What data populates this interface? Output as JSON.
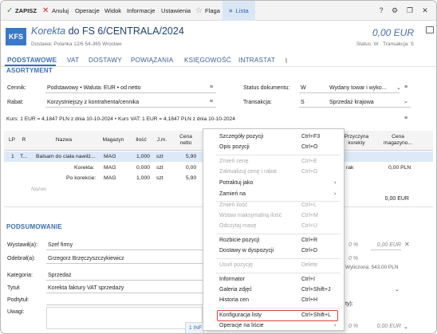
{
  "toolbar": {
    "save": "ZAPISZ",
    "cancel": "Anuluj",
    "operations": "Operacje",
    "view": "Widok",
    "information": "Informacje",
    "settings": "Ustawienia",
    "flag": "Flaga",
    "list": "Lista",
    "help": "?"
  },
  "header": {
    "badge": "KFS",
    "title_prefix": "Korekta",
    "title_rest": " do FS 6/CENTRALA/2024",
    "delivery": "Dostawa: Polanka  12/6  54-365 Wrocław",
    "amount": "0,00 EUR",
    "status_line": "Status:  W  · Transakcja:  S"
  },
  "tabs": [
    "PODSTAWOWE",
    "VAT",
    "DOSTAWY",
    "POWIĄZANIA",
    "KSIĘGOWOŚĆ",
    "INTRASTAT"
  ],
  "assortment": {
    "title": "ASORTYMENT",
    "cennik_label": "Cennik:",
    "cennik_value": "Podstawowy • Waluta: EUR • od netto",
    "rabat_label": "Rabat:",
    "rabat_value": "Korzystniejszy z kontrahenta/cennika",
    "status_label": "Status dokumentu:",
    "status_code": "W",
    "status_value": "Wydany towar i wyko...",
    "trans_label": "Transakcja:",
    "trans_code": "S",
    "trans_value": "Sprzedaż krajowa"
  },
  "kurs": "Kurs: 1 EUR = 4,1847 PLN z dnia 10-10-2024  •  Kurs VAT: 1 EUR = 4,1847 PLN z dnia 10-10-2024",
  "table": {
    "headers": {
      "lp": "LP",
      "r": "R",
      "name": "Nazwa",
      "warehouse": "Magazyn",
      "qty": "Ilość",
      "unit": "J.m.",
      "price_l1": "Cena",
      "price_l2": "netto",
      "reason_l1": "Przyczyna",
      "reason_l2": "korekty",
      "wprice_l1": "Cena",
      "wprice_l2": "magazyno..."
    },
    "rows": [
      {
        "lp": "1",
        "r": "T...",
        "name": "Balsam do ciała nawilż...",
        "wh": "MAG",
        "qty": "1,000",
        "unit": "szt",
        "price": "5,90",
        "reason": "",
        "wprice": ""
      },
      {
        "lp": "",
        "r": "",
        "name": "Korekta:",
        "wh": "MAG",
        "qty": "0,000",
        "unit": "szt",
        "price": "0,00",
        "reason": "rak",
        "wprice": "0,00 PLN"
      },
      {
        "lp": "",
        "r": "",
        "name": "Po korekcie:",
        "wh": "MAG",
        "qty": "1,000",
        "unit": "szt",
        "price": "5,90",
        "reason": "",
        "wprice": ""
      }
    ],
    "new_placeholder": "Nazwo",
    "total": "0,00 EUR"
  },
  "summary": {
    "title": "PODSUMOWANIE",
    "wystawil_label": "Wystawił(a):",
    "wystawil_value": "Szef firmy",
    "odebral_label": "Odebrał(a):",
    "odebral_value": "Grzegorz Brzęczyszczykiewicz",
    "kategoria_label": "Kategoria:",
    "kategoria_value": "Sprzedaż",
    "tytul_label": "Tytuł:",
    "tytul_value": "Korekta faktury VAT sprzedaży",
    "podtytul_label": "Podtytuł:",
    "uwagi_label": "Uwagi:",
    "pct1": "0 %",
    "amount1": "0,00 EUR",
    "pct2": "0 %",
    "computed": "Wyliczona: 543,00 PLN",
    "pct3": "0 %",
    "amount3": "0,00 EUR",
    "paren": "ty):",
    "bottom_tab": "1 INF"
  },
  "menu": {
    "items": [
      {
        "label": "Szczegóły pozycji",
        "shortcut": "Ctrl+F3",
        "disabled": false,
        "arrow": false
      },
      {
        "label": "Opis pozycji",
        "shortcut": "Ctrl+O",
        "disabled": false,
        "arrow": false
      },
      {
        "label": "Zmień cenę",
        "shortcut": "Ctrl+E",
        "disabled": true,
        "arrow": false
      },
      {
        "label": "Zaktualizuj cenę i rabat",
        "shortcut": "Ctrl+G",
        "disabled": true,
        "arrow": false
      },
      {
        "label": "Potraktuj jako",
        "shortcut": "",
        "disabled": false,
        "arrow": true
      },
      {
        "label": "Zamień na",
        "shortcut": "",
        "disabled": false,
        "arrow": true
      },
      {
        "label": "Zmień ilość",
        "shortcut": "Ctrl+L",
        "disabled": true,
        "arrow": false
      },
      {
        "label": "Wstaw maksymalną ilość",
        "shortcut": "Ctrl+M",
        "disabled": true,
        "arrow": false
      },
      {
        "label": "Odczytaj masę",
        "shortcut": "Ctrl+U",
        "disabled": true,
        "arrow": false
      },
      {
        "label": "Rozbicie pozycji",
        "shortcut": "Ctrl+R",
        "disabled": false,
        "arrow": false
      },
      {
        "label": "Dostawy w dyspozycji",
        "shortcut": "Ctrl+D",
        "disabled": false,
        "arrow": false
      },
      {
        "label": "Usuń pozycję",
        "shortcut": "Delete",
        "disabled": true,
        "arrow": false
      },
      {
        "label": "Informator",
        "shortcut": "Ctrl+I",
        "disabled": false,
        "arrow": false
      },
      {
        "label": "Galeria zdjęć",
        "shortcut": "Ctrl+Shift+J",
        "disabled": false,
        "arrow": false
      },
      {
        "label": "Historia cen",
        "shortcut": "Ctrl+H",
        "disabled": false,
        "arrow": false
      },
      {
        "label": "Konfiguracja listy",
        "shortcut": "Ctrl+Shift+L",
        "disabled": false,
        "arrow": false
      },
      {
        "label": "Operacje na liście",
        "shortcut": "",
        "disabled": false,
        "arrow": true
      }
    ]
  },
  "colors": {
    "accent": "#3d6fb0",
    "highlight_border": "#d9443a",
    "selected_row": "#dde9f7"
  }
}
